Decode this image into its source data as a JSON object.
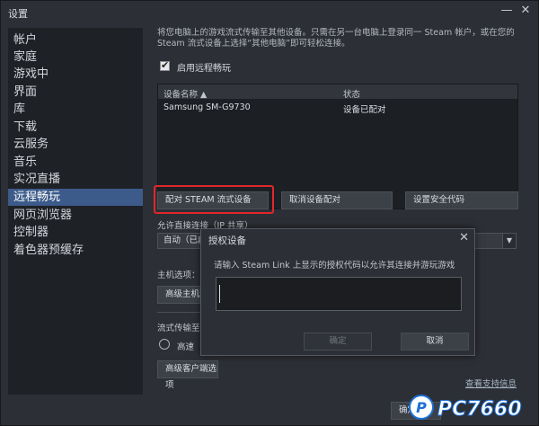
{
  "window": {
    "title": "设置",
    "minimize_glyph": "—",
    "close_glyph": "✕"
  },
  "sidebar": {
    "items": [
      {
        "label": "帐户"
      },
      {
        "label": "家庭"
      },
      {
        "label": "游戏中"
      },
      {
        "label": "界面"
      },
      {
        "label": "库"
      },
      {
        "label": "下载"
      },
      {
        "label": "云服务"
      },
      {
        "label": "音乐"
      },
      {
        "label": "实况直播"
      },
      {
        "label": "远程畅玩",
        "active": true
      },
      {
        "label": "网页浏览器"
      },
      {
        "label": "控制器"
      },
      {
        "label": "着色器预缓存"
      }
    ]
  },
  "main": {
    "description": "将您电脑上的游戏流式传输至其他设备。只需在另一台电脑上登录同一 Steam 帐户，或在您的 Steam 流式设备上选择“其他电脑”即可轻松连接。",
    "enable_checkbox": {
      "label": "启用远程畅玩",
      "checked": true
    },
    "device_table": {
      "columns": [
        "设备名称 ▲",
        "状态"
      ],
      "rows": [
        {
          "name": "Samsung SM-G9730",
          "status": "设备已配对"
        }
      ]
    },
    "buttons": {
      "pair_device": "配对 STEAM 流式设备",
      "unpair_device": "取消设备配对",
      "security_code": "设置安全代码"
    },
    "direct_connect": {
      "label": "允许直接连接（IP 共享）",
      "selected": "自动（已启"
    },
    "host_options": {
      "label": "主机选项：",
      "button": "高级主机选"
    },
    "streaming": {
      "label": "流式传输至",
      "radio_label": "高速",
      "advanced_button": "高级客户端选项"
    },
    "support_link": "查看支持信息",
    "ok_button": "确定"
  },
  "dialog": {
    "title": "授权设备",
    "close_glyph": "✕",
    "message": "请输入 Steam Link 上显示的授权代码以允许其连接并游玩游戏",
    "input_value": "",
    "confirm_button": "确定",
    "cancel_button": "取消"
  },
  "watermark": {
    "text": "PC7660"
  },
  "colors": {
    "accent": "#3c5b8a",
    "highlight_ring": "#e0272c",
    "watermark": "#1d6fd6"
  }
}
